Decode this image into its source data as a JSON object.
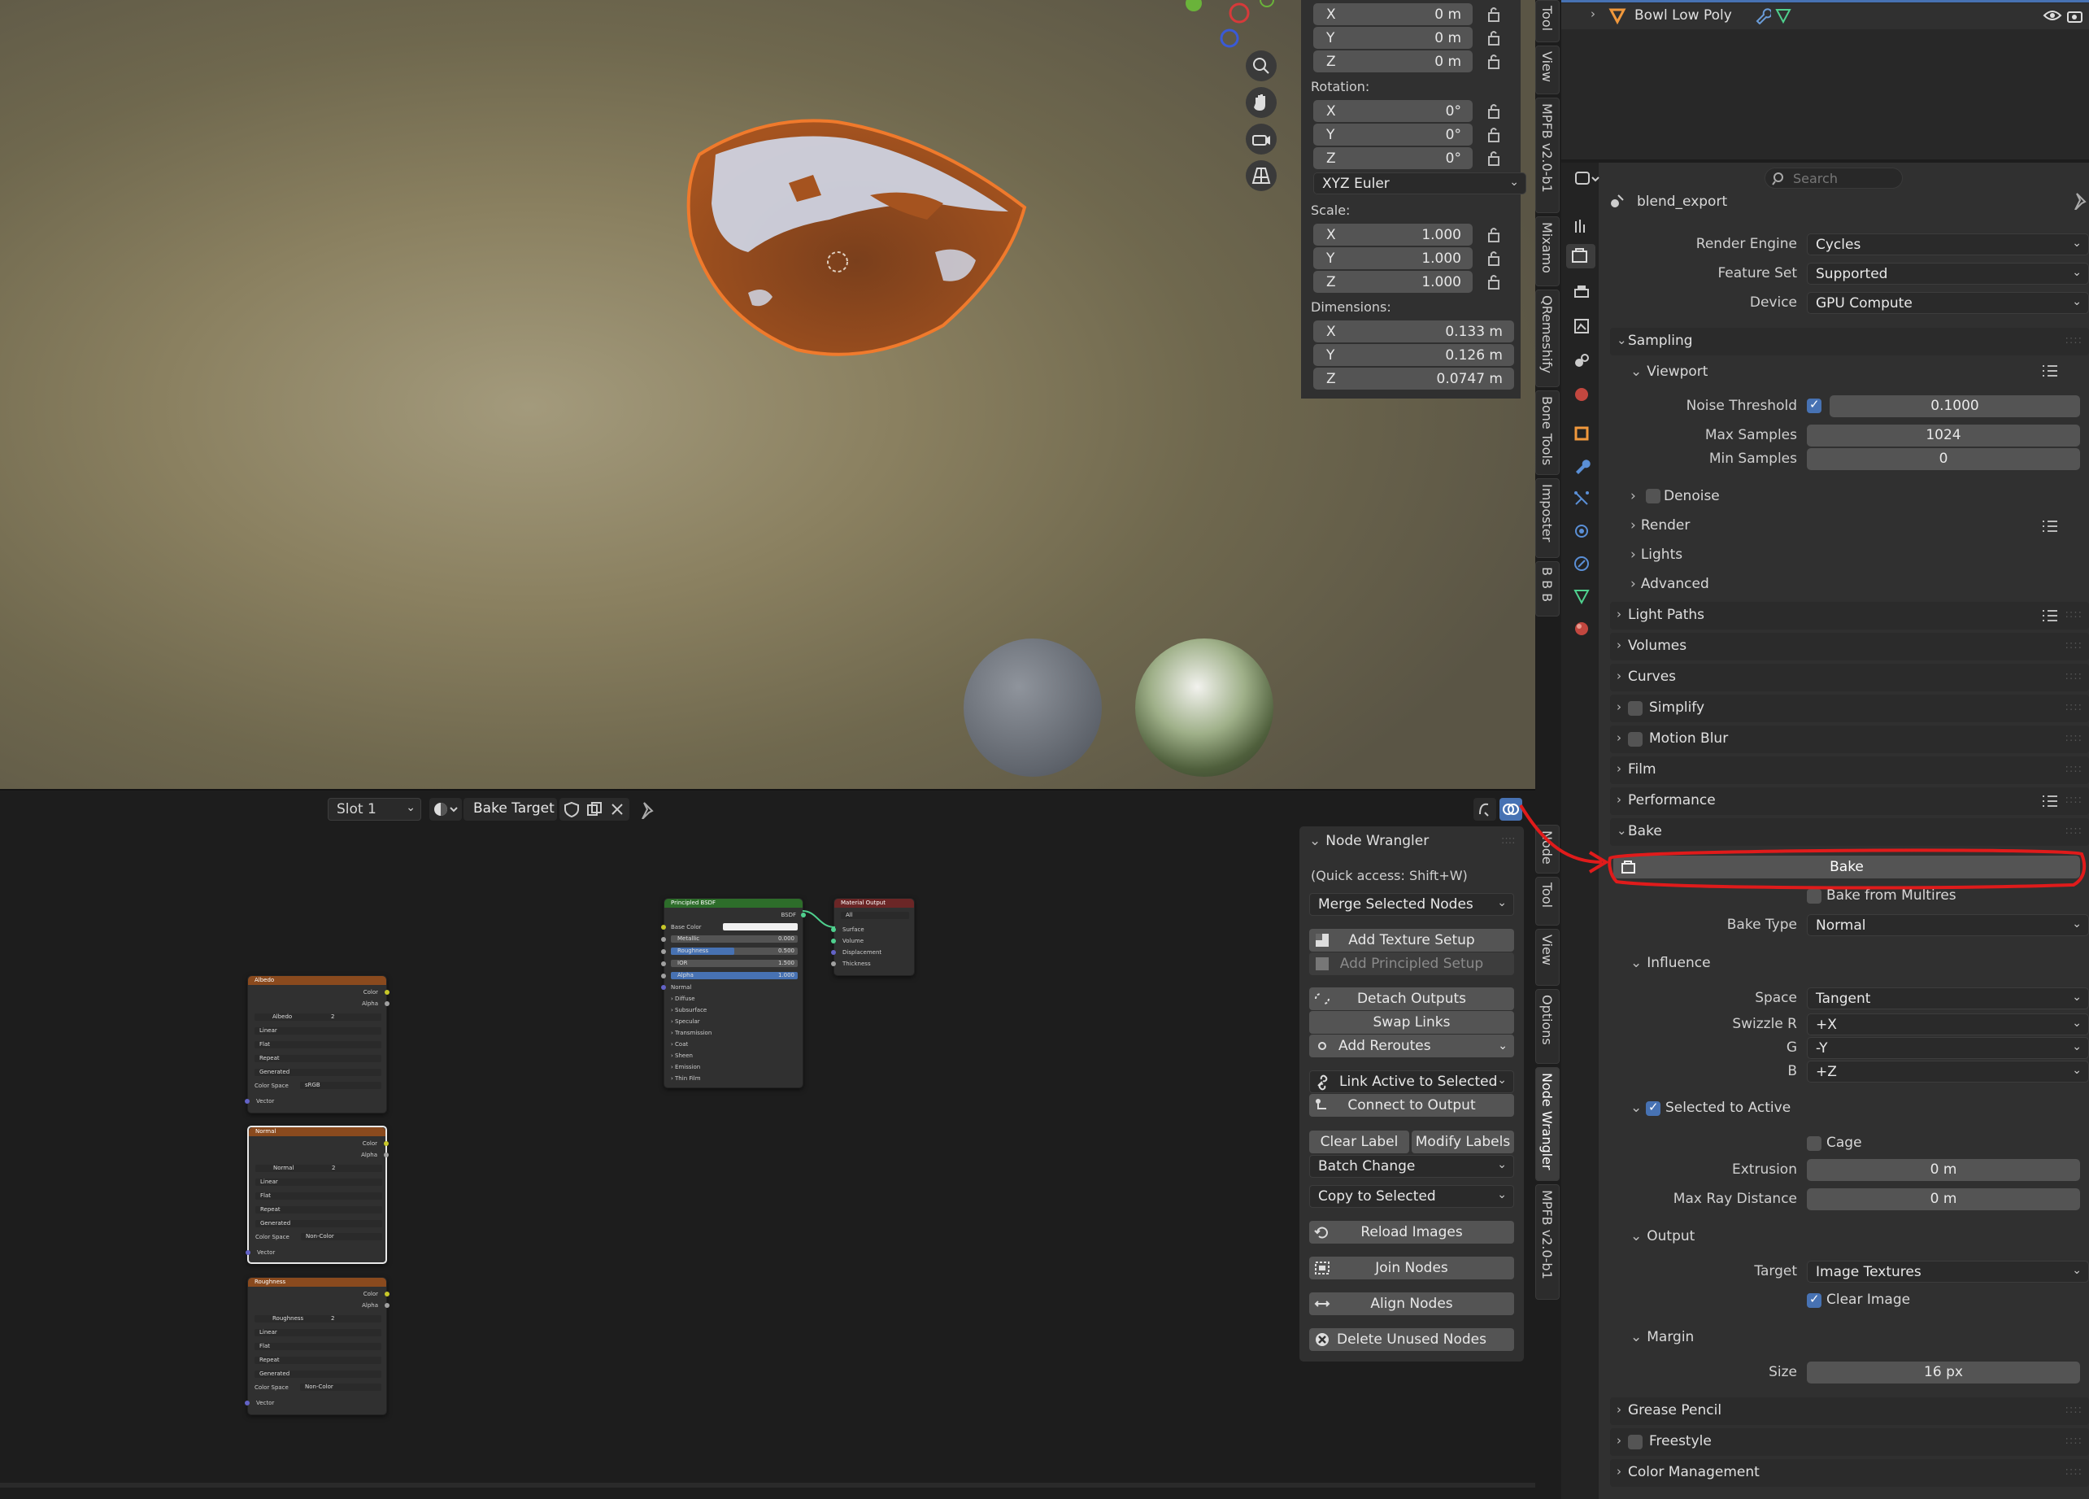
{
  "viewport": {
    "location": {
      "x": "0 m",
      "y": "0 m",
      "z": "0 m"
    },
    "rotation_label": "Rotation:",
    "rotation": {
      "x": "0°",
      "y": "0°",
      "z": "0°"
    },
    "rotation_mode": "XYZ Euler",
    "scale_label": "Scale:",
    "scale": {
      "x": "1.000",
      "y": "1.000",
      "z": "1.000"
    },
    "dimensions_label": "Dimensions:",
    "dimensions": {
      "x": "0.133 m",
      "y": "0.126 m",
      "z": "0.0747 m"
    },
    "axis": {
      "x": "X",
      "y": "Y",
      "z": "Z"
    },
    "side_tabs": [
      "Tool",
      "View",
      "MPFB v2.0-b1",
      "Mixamo",
      "QRemeshify",
      "Bone Tools",
      "Imposter",
      "B B B"
    ]
  },
  "outliner": {
    "item": "Bowl Low Poly"
  },
  "properties": {
    "search_placeholder": "Search",
    "scene_name": "blend_export",
    "render_engine_label": "Render Engine",
    "render_engine": "Cycles",
    "feature_set_label": "Feature Set",
    "feature_set": "Supported",
    "device_label": "Device",
    "device": "GPU Compute",
    "sampling": "Sampling",
    "viewport": "Viewport",
    "noise_threshold_label": "Noise Threshold",
    "noise_threshold": "0.1000",
    "max_samples_label": "Max Samples",
    "max_samples": "1024",
    "min_samples_label": "Min Samples",
    "min_samples": "0",
    "denoise": "Denoise",
    "render": "Render",
    "lights": "Lights",
    "advanced": "Advanced",
    "panels": [
      "Light Paths",
      "Volumes",
      "Curves",
      "Simplify",
      "Motion Blur",
      "Film",
      "Performance"
    ],
    "bake": "Bake",
    "bake_button": "Bake",
    "bake_from_multires": "Bake from Multires",
    "bake_type_label": "Bake Type",
    "bake_type": "Normal",
    "influence": "Influence",
    "space_label": "Space",
    "space": "Tangent",
    "swizzle_r_label": "Swizzle R",
    "swizzle_r": "+X",
    "g_label": "G",
    "g": "-Y",
    "b_label": "B",
    "b": "+Z",
    "selected_to_active": "Selected to Active",
    "cage": "Cage",
    "extrusion_label": "Extrusion",
    "extrusion": "0 m",
    "max_ray_label": "Max Ray Distance",
    "max_ray": "0 m",
    "output": "Output",
    "target_label": "Target",
    "target": "Image Textures",
    "clear_image": "Clear Image",
    "margin": "Margin",
    "size_label": "Size",
    "size": "16 px",
    "bottom_panels": [
      "Grease Pencil",
      "Freestyle",
      "Color Management"
    ]
  },
  "node_editor": {
    "slot": "Slot 1",
    "material": "Bake Target",
    "side_tabs": [
      "Node",
      "Tool",
      "View",
      "Options",
      "Node Wrangler",
      "MPFB v2.0-b1"
    ],
    "nw_title": "Node Wrangler",
    "nw_quick": "(Quick access: Shift+W)",
    "merge": "Merge Selected Nodes",
    "add_texture": "Add Texture Setup",
    "add_principled": "Add Principled Setup",
    "detach": "Detach Outputs",
    "swap": "Swap Links",
    "reroutes": "Add Reroutes",
    "link_active": "Link Active to Selected",
    "connect_output": "Connect to Output",
    "clear_label": "Clear Label",
    "modify_labels": "Modify Labels",
    "batch": "Batch Change",
    "copy_selected": "Copy to Selected",
    "reload": "Reload Images",
    "join": "Join Nodes",
    "align": "Align Nodes",
    "delete_unused": "Delete Unused Nodes",
    "nodes": {
      "principled": {
        "title": "Principled BSDF",
        "out": "BSDF",
        "base_color": "Base Color",
        "metallic": "Metallic",
        "metallic_v": "0.000",
        "roughness": "Roughness",
        "roughness_v": "0.500",
        "ior": "IOR",
        "ior_v": "1.500",
        "alpha": "Alpha",
        "alpha_v": "1.000",
        "normal": "Normal",
        "subs": [
          "Diffuse",
          "Subsurface",
          "Specular",
          "Transmission",
          "Coat",
          "Sheen",
          "Emission",
          "Thin Film"
        ]
      },
      "output": {
        "title": "Material Output",
        "target": "All",
        "surface": "Surface",
        "volume": "Volume",
        "displacement": "Displacement",
        "thickness": "Thickness"
      },
      "albedo": {
        "title": "Albedo",
        "img": "Albedo",
        "cs": "sRGB"
      },
      "normal": {
        "title": "Normal",
        "img": "Normal",
        "cs": "Non-Color"
      },
      "roughness": {
        "title": "Roughness",
        "img": "Roughness",
        "cs": "Non-Color"
      },
      "tex_common": {
        "color": "Color",
        "alpha": "Alpha",
        "users": "2",
        "interp": "Linear",
        "proj": "Flat",
        "ext": "Repeat",
        "src": "Generated",
        "cs_label": "Color Space",
        "vector": "Vector"
      }
    }
  },
  "colors": {
    "accent_blue": "#4772b3",
    "annotation_red": "#e01b1b",
    "texture_header": "#8a4a1e",
    "shader_header": "#2d6d2a",
    "output_header": "#6b2626"
  }
}
